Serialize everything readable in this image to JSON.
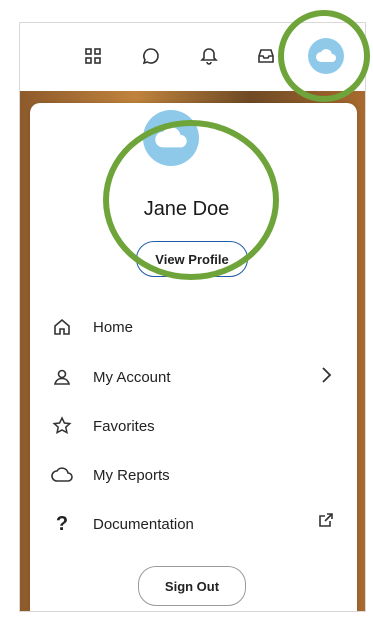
{
  "user": {
    "name": "Jane Doe"
  },
  "profile": {
    "view_label": "View Profile"
  },
  "menu": [
    {
      "label": "Home",
      "icon": "home-icon"
    },
    {
      "label": "My Account",
      "icon": "user-icon",
      "trailing": "chevron-right-icon"
    },
    {
      "label": "Favorites",
      "icon": "star-icon"
    },
    {
      "label": "My Reports",
      "icon": "cloud-outline-icon"
    },
    {
      "label": "Documentation",
      "icon": "question-icon",
      "trailing": "external-link-icon"
    }
  ],
  "footer": {
    "signout_label": "Sign Out"
  },
  "colors": {
    "highlight": "#6ea43a",
    "avatar": "#8fc9ea",
    "accent": "#1f5aa6"
  }
}
